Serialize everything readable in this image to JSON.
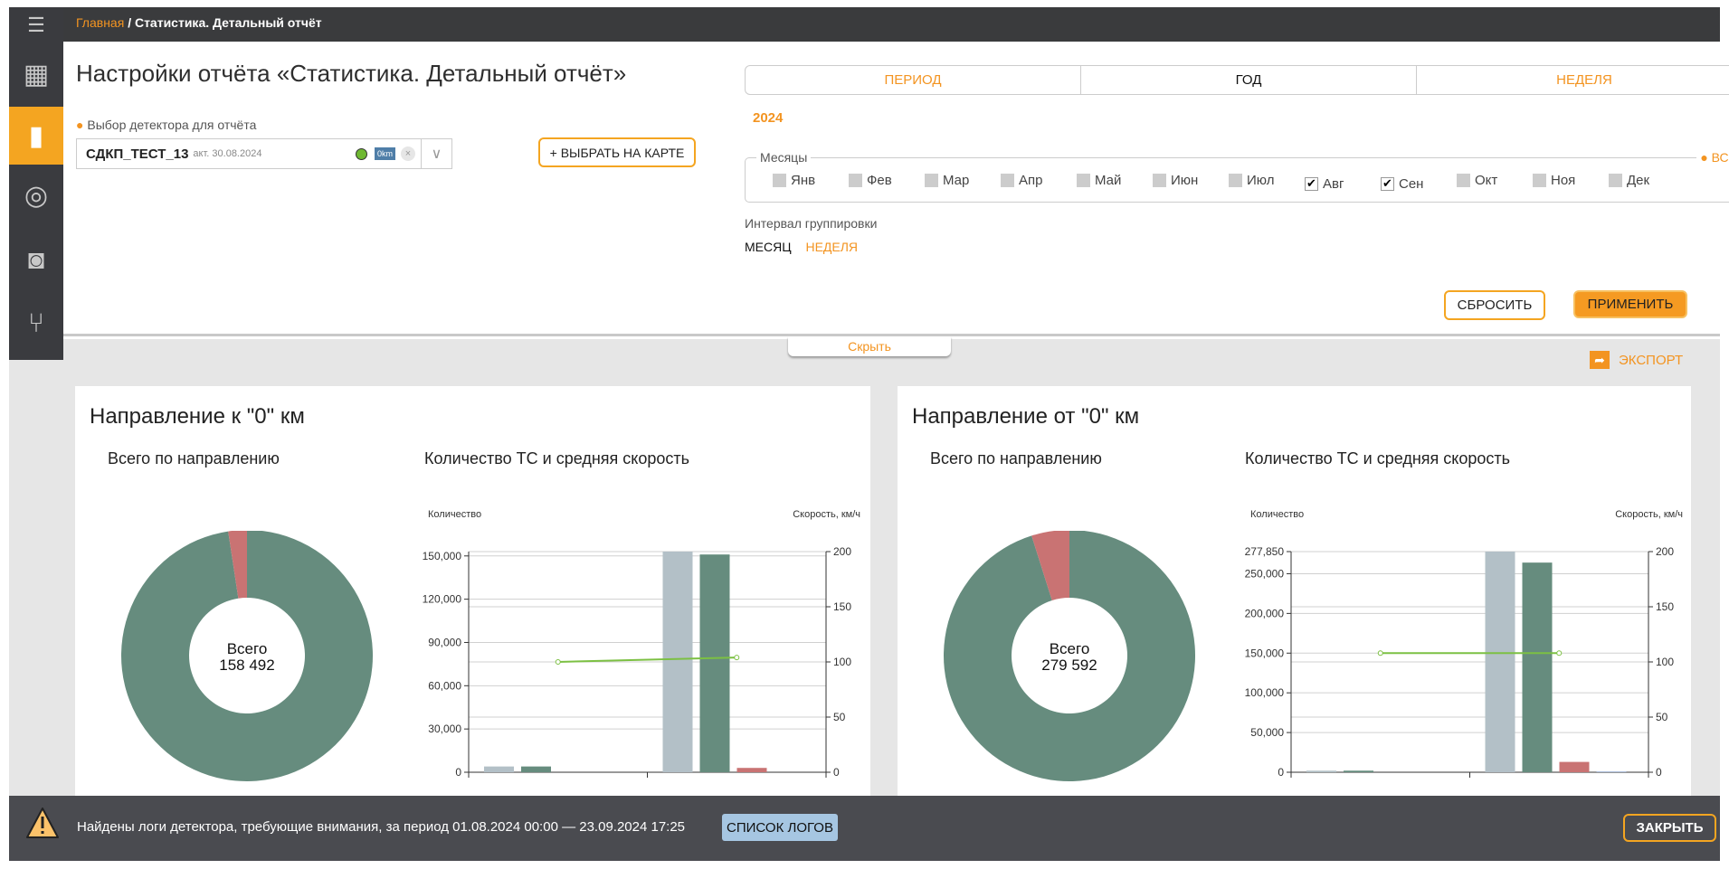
{
  "breadcrumb": {
    "home": "Главная",
    "separator": "/",
    "current": "Статистика. Детальный отчёт"
  },
  "sidebar": {
    "items": [
      {
        "icon": "map-icon"
      },
      {
        "icon": "report-icon",
        "active": true
      },
      {
        "icon": "ring-icon"
      },
      {
        "icon": "sim-card-icon"
      },
      {
        "icon": "network-icon"
      }
    ]
  },
  "settings": {
    "title": "Настройки отчёта «Статистика. Детальный отчёт»",
    "detector_label": "Выбор детектора для отчёта",
    "detector_name": "СДКП_ТЕСТ_13",
    "detector_date": "акт. 30.08.2024",
    "detector_badge": "0km",
    "select_on_map": "+ ВЫБРАТЬ НА КАРТЕ",
    "tabs": [
      "ПЕРИОД",
      "ГОД",
      "НЕДЕЛЯ"
    ],
    "active_tab": "ГОД",
    "year": "2024",
    "months_label": "Месяцы",
    "all_label": "ВСЕ",
    "months": [
      {
        "label": "Янв",
        "checked": false
      },
      {
        "label": "Фев",
        "checked": false
      },
      {
        "label": "Мар",
        "checked": false
      },
      {
        "label": "Апр",
        "checked": false
      },
      {
        "label": "Май",
        "checked": false
      },
      {
        "label": "Июн",
        "checked": false
      },
      {
        "label": "Июл",
        "checked": false
      },
      {
        "label": "Авг",
        "checked": true
      },
      {
        "label": "Сен",
        "checked": true
      },
      {
        "label": "Окт",
        "checked": false
      },
      {
        "label": "Ноя",
        "checked": false
      },
      {
        "label": "Дек",
        "checked": false
      }
    ],
    "grouping_label": "Интервал группировки",
    "grouping_options": [
      "МЕСЯЦ",
      "НЕДЕЛЯ"
    ],
    "grouping_selected": "МЕСЯЦ",
    "reset": "СБРОСИТЬ",
    "apply": "ПРИМЕНИТЬ",
    "hide": "Скрыть"
  },
  "export": "ЭКСПОРТ",
  "cards": [
    {
      "title": "Направление к \"0\" км",
      "donut_title": "Всего по направлению",
      "chart_title": "Количество ТС и средняя скорость",
      "total_label": "Всего",
      "total": "158 492"
    },
    {
      "title": "Направление от \"0\" км",
      "donut_title": "Всего по направлению",
      "chart_title": "Количество ТС и средняя скорость",
      "total_label": "Всего",
      "total": "279 592"
    }
  ],
  "colors": {
    "accent": "#f4a521",
    "green": "#668c7e",
    "gray": "#b3c0c7",
    "red": "#c97373",
    "blue": "#9fb3d4",
    "line": "#7cc043"
  },
  "chart_data": [
    {
      "type": "pie",
      "donut": true,
      "values": [
        {
          "color": "#668c7e",
          "value": 154700
        },
        {
          "color": "#c97373",
          "value": 3792
        }
      ]
    },
    {
      "type": "bar",
      "ylabel": "Количество",
      "y2label": "Скорость, км/ч",
      "ylim": [
        0,
        153000
      ],
      "yticks": [
        "0",
        "30,000",
        "60,000",
        "90,000",
        "120,000",
        "150,000"
      ],
      "y2lim": [
        0,
        200
      ],
      "y2ticks": [
        "0",
        "50",
        "100",
        "150",
        "200"
      ],
      "groups": 2,
      "series": [
        {
          "color": "#b3c0c7",
          "values": [
            4000,
            153000
          ]
        },
        {
          "color": "#668c7e",
          "values": [
            4000,
            151000
          ]
        },
        {
          "color": "#c97373",
          "values": [
            0,
            3000
          ]
        },
        {
          "color": "#9fb3d4",
          "values": [
            0,
            0
          ]
        }
      ],
      "speed": [
        100,
        104
      ]
    },
    {
      "type": "pie",
      "donut": true,
      "values": [
        {
          "color": "#668c7e",
          "value": 266000
        },
        {
          "color": "#c97373",
          "value": 13592
        }
      ]
    },
    {
      "type": "bar",
      "ylabel": "Количество",
      "y2label": "Скорость, км/ч",
      "ylim": [
        0,
        277850
      ],
      "yticks": [
        "0",
        "50,000",
        "100,000",
        "150,000",
        "200,000",
        "250,000",
        "277,850"
      ],
      "y2lim": [
        0,
        200
      ],
      "y2ticks": [
        "0",
        "50",
        "100",
        "150",
        "200"
      ],
      "groups": 2,
      "series": [
        {
          "color": "#b3c0c7",
          "values": [
            2000,
            277850
          ]
        },
        {
          "color": "#668c7e",
          "values": [
            2000,
            264000
          ]
        },
        {
          "color": "#c97373",
          "values": [
            0,
            13000
          ]
        },
        {
          "color": "#9fb3d4",
          "values": [
            0,
            1000
          ]
        }
      ],
      "speed": [
        108,
        108
      ]
    }
  ],
  "bottom": {
    "message": "Найдены логи детектора, требующие внимания, за период 01.08.2024 00:00 — 23.09.2024 17:25",
    "logs_button": "СПИСОК ЛОГОВ",
    "close": "ЗАКРЫТЬ"
  }
}
